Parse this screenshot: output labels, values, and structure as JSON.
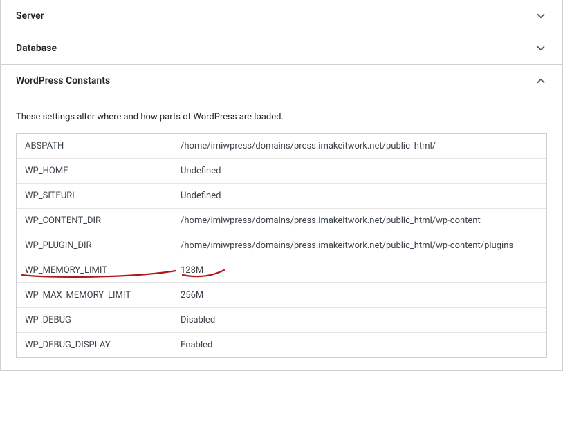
{
  "panels": {
    "server": {
      "title": "Server"
    },
    "database": {
      "title": "Database"
    },
    "constants": {
      "title": "WordPress Constants",
      "description": "These settings alter where and how parts of WordPress are loaded.",
      "rows": [
        {
          "key": "ABSPATH",
          "value": "/home/imiwpress/domains/press.imakeitwork.net/public_html/"
        },
        {
          "key": "WP_HOME",
          "value": "Undefined"
        },
        {
          "key": "WP_SITEURL",
          "value": "Undefined"
        },
        {
          "key": "WP_CONTENT_DIR",
          "value": "/home/imiwpress/domains/press.imakeitwork.net/public_html/wp-content"
        },
        {
          "key": "WP_PLUGIN_DIR",
          "value": "/home/imiwpress/domains/press.imakeitwork.net/public_html/wp-content/plugins"
        },
        {
          "key": "WP_MEMORY_LIMIT",
          "value": "128M"
        },
        {
          "key": "WP_MAX_MEMORY_LIMIT",
          "value": "256M"
        },
        {
          "key": "WP_DEBUG",
          "value": "Disabled"
        },
        {
          "key": "WP_DEBUG_DISPLAY",
          "value": "Enabled"
        }
      ]
    }
  },
  "annotation": {
    "color": "#b01818"
  }
}
